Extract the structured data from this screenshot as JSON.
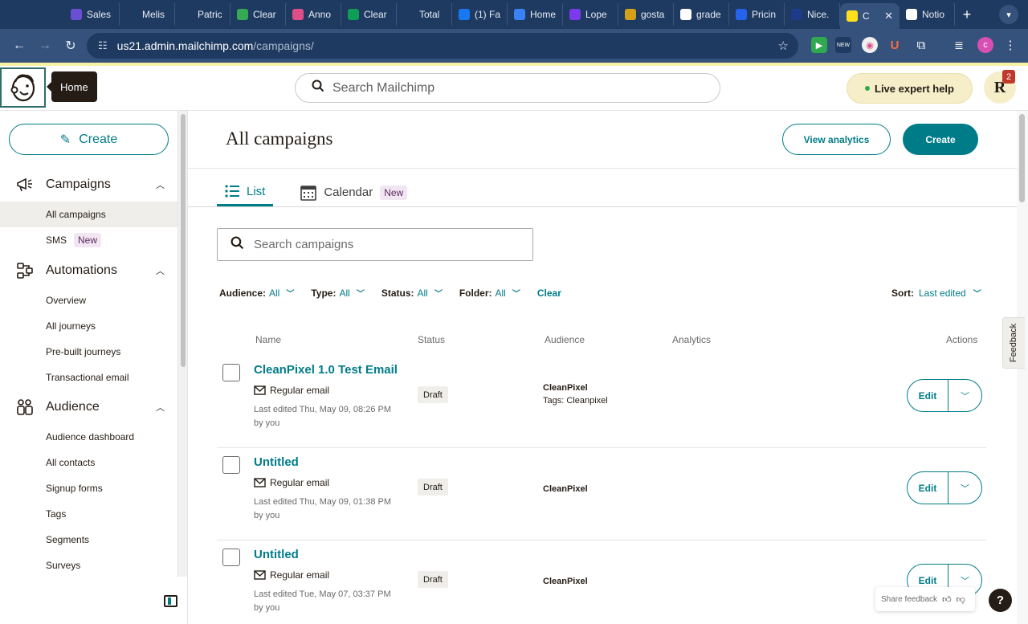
{
  "browser": {
    "tabs": [
      {
        "label": "Sales",
        "color": "#6b4fd3"
      },
      {
        "label": "Melis",
        "color": "#1f3a60"
      },
      {
        "label": "Patric",
        "color": "#1f3a60"
      },
      {
        "label": "Clear",
        "color": "#34a853"
      },
      {
        "label": "Anno",
        "color": "#e04e8a"
      },
      {
        "label": "Clear",
        "color": "#0f9d58"
      },
      {
        "label": "Total",
        "color": "#1f3a60"
      },
      {
        "label": "(1) Fa",
        "color": "#1877f2"
      },
      {
        "label": "Home",
        "color": "#3b82f6"
      },
      {
        "label": "Lope",
        "color": "#7c3aed"
      },
      {
        "label": "gosta",
        "color": "#d4a017"
      },
      {
        "label": "grade",
        "color": "#ffffff"
      },
      {
        "label": "Pricin",
        "color": "#2563eb"
      },
      {
        "label": "Nice.",
        "color": "#1e3a8a"
      },
      {
        "label": "C",
        "color": "#ffe01b",
        "active": true
      },
      {
        "label": "Notio",
        "color": "#ffffff"
      }
    ],
    "url_host": "us21.admin.mailchimp.com",
    "url_path": "/campaigns/"
  },
  "header": {
    "tooltip": "Home",
    "search_placeholder": "Search Mailchimp",
    "live_help": "Live expert help",
    "avatar_initial": "R",
    "notification_count": "2"
  },
  "sidebar": {
    "create_label": "Create",
    "sections": [
      {
        "label": "Campaigns",
        "icon": "megaphone-icon",
        "items": [
          {
            "label": "All campaigns",
            "active": true
          },
          {
            "label": "SMS",
            "badge": "New"
          }
        ]
      },
      {
        "label": "Automations",
        "icon": "automations-icon",
        "items": [
          {
            "label": "Overview"
          },
          {
            "label": "All journeys"
          },
          {
            "label": "Pre-built journeys"
          },
          {
            "label": "Transactional email"
          }
        ]
      },
      {
        "label": "Audience",
        "icon": "audience-icon",
        "items": [
          {
            "label": "Audience dashboard"
          },
          {
            "label": "All contacts"
          },
          {
            "label": "Signup forms"
          },
          {
            "label": "Tags"
          },
          {
            "label": "Segments"
          },
          {
            "label": "Surveys"
          }
        ]
      }
    ]
  },
  "main": {
    "title": "All campaigns",
    "view_analytics": "View analytics",
    "create": "Create",
    "tabs": [
      {
        "label": "List",
        "icon": "list-icon",
        "active": true
      },
      {
        "label": "Calendar",
        "icon": "calendar-icon",
        "badge": "New"
      }
    ],
    "search_placeholder": "Search campaigns",
    "filters": [
      {
        "label": "Audience:",
        "value": "All"
      },
      {
        "label": "Type:",
        "value": "All"
      },
      {
        "label": "Status:",
        "value": "All"
      },
      {
        "label": "Folder:",
        "value": "All"
      }
    ],
    "clear": "Clear",
    "sort_label": "Sort:",
    "sort_value": "Last edited",
    "columns": {
      "name": "Name",
      "status": "Status",
      "audience": "Audience",
      "analytics": "Analytics",
      "actions": "Actions"
    },
    "campaigns": [
      {
        "name": "CleanPixel 1.0 Test Email",
        "type": "Regular email",
        "edited": "Last edited Thu, May 09, 08:26 PM by you",
        "status": "Draft",
        "audience": "CleanPixel",
        "tags": "Tags: Cleanpixel",
        "action": "Edit"
      },
      {
        "name": "Untitled",
        "type": "Regular email",
        "edited": "Last edited Thu, May 09, 01:38 PM by you",
        "status": "Draft",
        "audience": "CleanPixel",
        "tags": "",
        "action": "Edit"
      },
      {
        "name": "Untitled",
        "type": "Regular email",
        "edited": "Last edited Tue, May 07, 03:37 PM by you",
        "status": "Draft",
        "audience": "CleanPixel",
        "tags": "",
        "action": "Edit"
      }
    ]
  },
  "feedback": {
    "tab_label": "Feedback",
    "share_label": "Share feedback",
    "help_label": "?"
  },
  "colors": {
    "accent": "#007c89",
    "browser_dark": "#1f3a60",
    "browser_mid": "#35527c"
  }
}
